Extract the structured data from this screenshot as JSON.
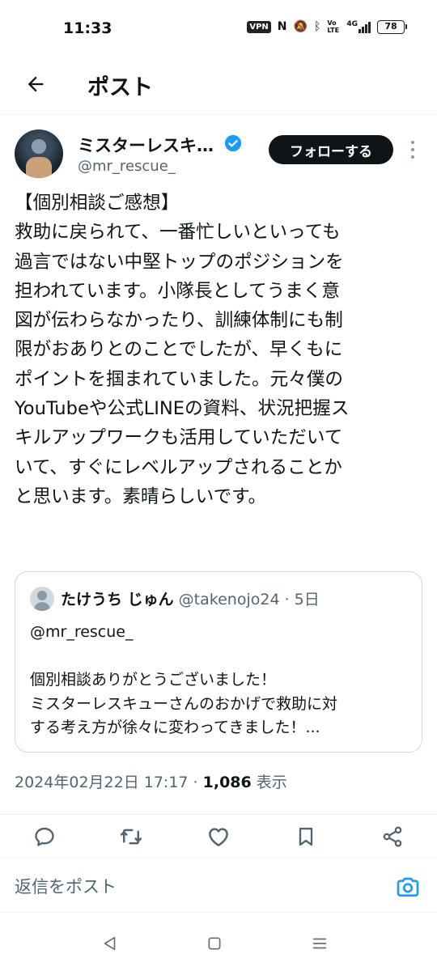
{
  "status_bar": {
    "time": "11:33",
    "vpn": "VPN",
    "nfc": "N",
    "mute": "🔕",
    "bluetooth": "ᛒ",
    "volte": "Vo LTE",
    "network": "4G",
    "battery": "78"
  },
  "header": {
    "title": "ポスト"
  },
  "author": {
    "name": "ミスターレスキ…",
    "handle": "@mr_rescue_",
    "follow_label": "フォローする"
  },
  "post": {
    "text": "【個別相談ご感想】\n救助に戻られて、一番忙しいといっても\n過言ではない中堅トップのポジションを\n担われています。小隊長としてうまく意\n図が伝わらなかったり、訓練体制にも制\n限がおありとのことでしたが、早くもに\nポイントを掴まれていました。元々僕の\nYouTubeや公式LINEの資料、状況把握ス\nキルアップワークも活用していただいて\nいて、すぐにレベルアップされることか\nと思います。素晴らしいです。"
  },
  "quote": {
    "name": "たけうち じゅん",
    "handle": "@takenojo24",
    "separator": " · ",
    "time": "5日",
    "text": "@mr_rescue_\n\n個別相談ありがとうございました！\nミスターレスキューさんのおかげで救助に対\nする考え方が徐々に変わってきました！..."
  },
  "meta": {
    "timestamp": "2024年02月22日 17:17",
    "separator": " · ",
    "views_count": "1,086",
    "views_label": " 表示"
  },
  "actions": {
    "icons": [
      "reply-icon",
      "repost-icon",
      "like-icon",
      "bookmark-icon",
      "share-icon"
    ]
  },
  "reply": {
    "placeholder": "返信をポスト"
  },
  "colors": {
    "text": "#0f1419",
    "secondary": "#536471",
    "accent": "#1d9bf0",
    "border": "#cfd9de"
  }
}
